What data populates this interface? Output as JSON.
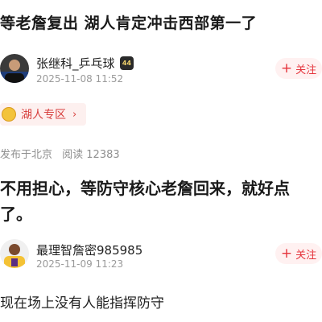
{
  "post": {
    "title": "等老詹复出 湖人肯定冲击西部第一了"
  },
  "author": {
    "name": "张继科_乒乓球",
    "time": "2025-11-08 11:52",
    "badge": "44",
    "follow_label": "关注"
  },
  "topic": {
    "label": "湖人专区",
    "chevron": "›"
  },
  "meta": {
    "location": "发布于北京",
    "views": "阅读 12383"
  },
  "content": {
    "text": "不用担心，等防守核心老詹回来，就好点了。"
  },
  "reply": {
    "name": "最理智詹密985985",
    "time": "2025-11-09 11:23",
    "follow_label": "关注",
    "text": "现在场上没有人能指挥防守"
  },
  "colors": {
    "accent": "#e5333b",
    "follow_bg": "#fff1f1",
    "topic_bg": "#fdf0ef",
    "muted": "#9a9a9a"
  }
}
